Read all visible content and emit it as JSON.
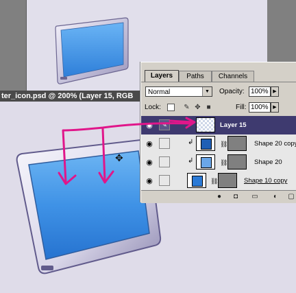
{
  "document": {
    "title": "ter_icon.psd @ 200% (Layer 15, RGB"
  },
  "layers_panel": {
    "tabs": [
      {
        "label": "Layers",
        "active": true
      },
      {
        "label": "Paths",
        "active": false
      },
      {
        "label": "Channels",
        "active": false
      }
    ],
    "blend_mode": "Normal",
    "opacity_label": "Opacity:",
    "opacity_value": "100%",
    "lock_label": "Lock:",
    "fill_label": "Fill:",
    "fill_value": "100%",
    "layers": [
      {
        "name": "Layer 15",
        "selected": true
      },
      {
        "name": "Shape 20 copy",
        "selected": false
      },
      {
        "name": "Shape 20",
        "selected": false
      },
      {
        "name": "Shape 10 copy",
        "selected": false
      }
    ]
  },
  "colors": {
    "screen_blue": "#3c8fe6",
    "selected_row": "#3e3a6f",
    "annotation": "#e0168a",
    "panel_bg": "#d4d0c8"
  },
  "icons": [
    "eye-icon",
    "brush-icon",
    "link-icon",
    "lock-icon",
    "move-icon",
    "clip-arrow-icon",
    "new-layer-icon",
    "trash-icon"
  ]
}
